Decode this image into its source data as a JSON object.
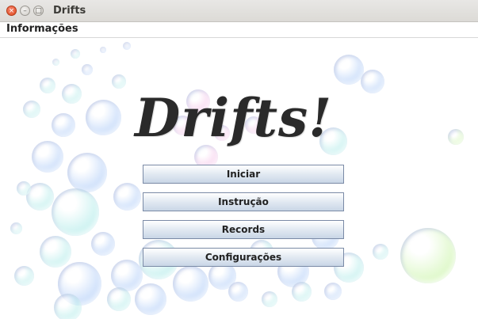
{
  "window": {
    "title": "Drifts"
  },
  "menubar": {
    "items": [
      {
        "label": "Informações"
      }
    ]
  },
  "main": {
    "logo_text": "Drifts!",
    "buttons": [
      {
        "label": "Iniciar"
      },
      {
        "label": "Instrução"
      },
      {
        "label": "Records"
      },
      {
        "label": "Configurações"
      }
    ]
  },
  "colors": {
    "bubble_blue": "#8fb8f5",
    "bubble_cyan": "#8fe3e0",
    "bubble_pink": "#f2a8de",
    "bubble_green": "#b8f08a",
    "button_border": "#7a8aa6"
  }
}
